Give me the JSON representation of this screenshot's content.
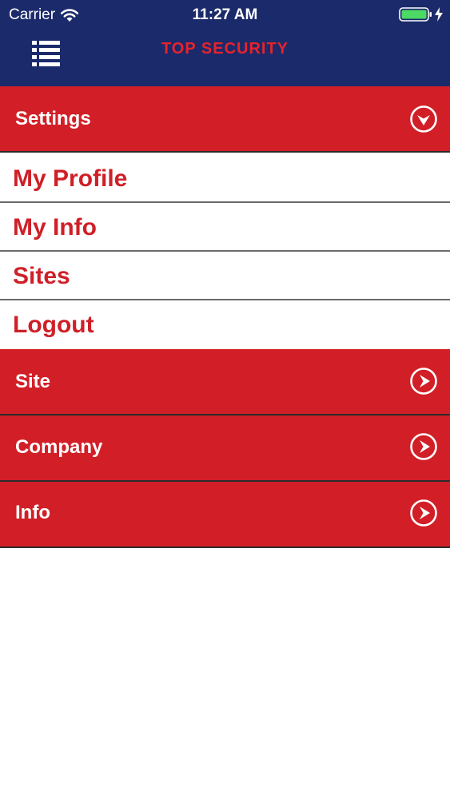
{
  "status_bar": {
    "carrier": "Carrier",
    "time": "11:27 AM",
    "battery_color": "#4cd964"
  },
  "nav": {
    "title": "TOP SECURITY",
    "title_color": "#e8232b",
    "background_color": "#1b2a6b",
    "menu_icon": "menu-list-icon"
  },
  "settings": {
    "label": "Settings",
    "expanded": true,
    "icon": "chevron-down-circle-icon",
    "items": [
      {
        "label": "My Profile"
      },
      {
        "label": "My Info"
      },
      {
        "label": "Sites"
      },
      {
        "label": "Logout"
      }
    ]
  },
  "sections": [
    {
      "label": "Site",
      "icon": "chevron-right-circle-icon"
    },
    {
      "label": "Company",
      "icon": "chevron-right-circle-icon"
    },
    {
      "label": "Info",
      "icon": "chevron-right-circle-icon"
    }
  ],
  "colors": {
    "section_red": "#d21f27",
    "item_text_red": "#cf1f27"
  }
}
